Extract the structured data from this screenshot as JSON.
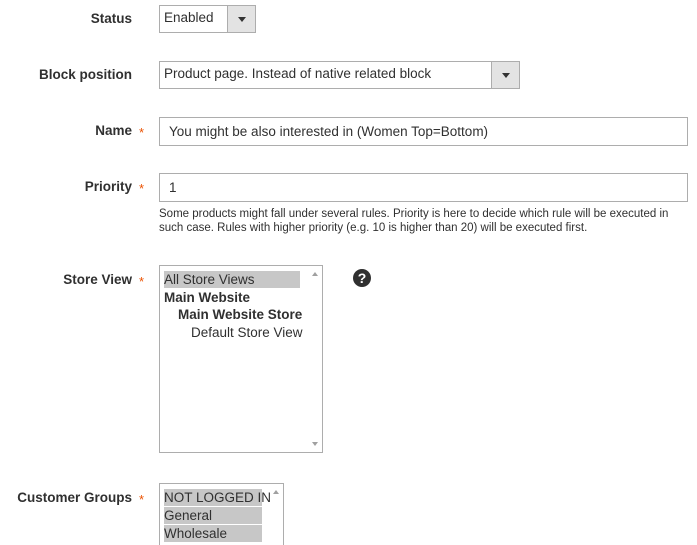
{
  "status": {
    "label": "Status",
    "value": "Enabled"
  },
  "block_position": {
    "label": "Block position",
    "value": "Product page. Instead of native related block"
  },
  "name": {
    "label": "Name",
    "required_mark": "*",
    "value": "You might be also interested in (Women Top=Bottom)"
  },
  "priority": {
    "label": "Priority",
    "required_mark": "*",
    "value": "1",
    "note_line1": "Some products might fall under several rules. Priority is here to decide which rule will be executed in",
    "note_line2": "such case. Rules with higher priority (e.g. 10 is higher than 20) will be executed first."
  },
  "store_view": {
    "label": "Store View",
    "required_mark": "*",
    "help_icon": "?",
    "options": [
      {
        "label": "All Store Views",
        "selected": true,
        "bold": false,
        "indent": 0
      },
      {
        "label": "Main Website",
        "selected": false,
        "bold": true,
        "indent": 0
      },
      {
        "label": "Main Website Store",
        "selected": false,
        "bold": true,
        "indent": 1
      },
      {
        "label": "Default Store View",
        "selected": false,
        "bold": false,
        "indent": 2
      }
    ]
  },
  "customer_groups": {
    "label": "Customer Groups",
    "required_mark": "*",
    "options": [
      {
        "label": "NOT LOGGED IN",
        "selected": true
      },
      {
        "label": "General",
        "selected": true
      },
      {
        "label": "Wholesale",
        "selected": true
      }
    ]
  },
  "colors": {
    "required": "#eb5202",
    "border": "#adadad",
    "selected_bg": "#c7c7c7"
  }
}
